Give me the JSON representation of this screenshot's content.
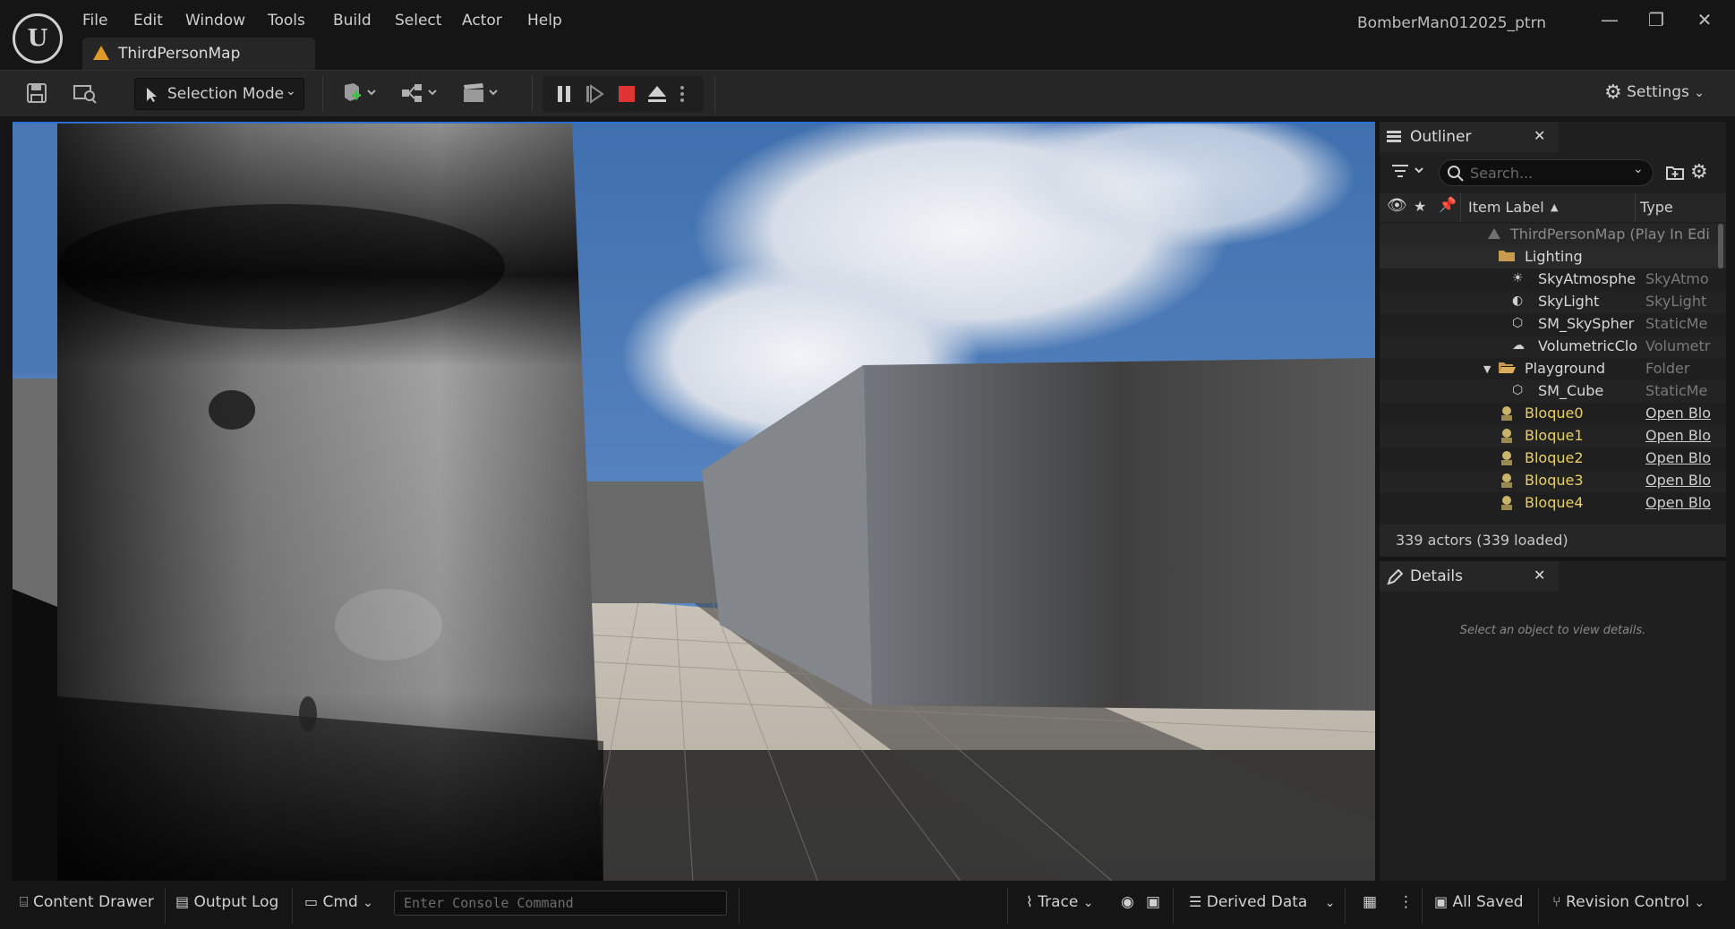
{
  "window": {
    "project_name": "BomberMan012025_ptrn",
    "minimize_glyph": "—",
    "restore_glyph": "❐",
    "close_glyph": "✕"
  },
  "menu": [
    "File",
    "Edit",
    "Window",
    "Tools",
    "Build",
    "Select",
    "Actor",
    "Help"
  ],
  "tab": {
    "label": "ThirdPersonMap"
  },
  "toolbar": {
    "selection_mode": "Selection Mode",
    "settings": "Settings",
    "icons": [
      "save-icon",
      "browse-icon",
      "add-actor-icon",
      "blueprint-icon",
      "cinematics-icon",
      "pause-icon",
      "step-icon",
      "stop-icon",
      "eject-icon",
      "more-icon",
      "gear-icon"
    ]
  },
  "outliner": {
    "title": "Outliner",
    "search_placeholder": "Search...",
    "col_label": "Item Label",
    "col_type": "Type",
    "rows": [
      {
        "label": "ThirdPersonMap (Play In Edi",
        "type": "",
        "icon": "map-icon"
      },
      {
        "label": "Lighting",
        "type": "",
        "icon": "folder-icon"
      },
      {
        "label": "SkyAtmosphe",
        "type": "SkyAtmo",
        "icon": "sky-atmosphere-icon"
      },
      {
        "label": "SkyLight",
        "type": "SkyLight",
        "icon": "skylight-icon"
      },
      {
        "label": "SM_SkySpher",
        "type": "StaticMe",
        "icon": "static-mesh-icon"
      },
      {
        "label": "VolumetricClo",
        "type": "Volumetr",
        "icon": "volumetric-cloud-icon"
      },
      {
        "label": "Playground",
        "type": "Folder",
        "icon": "folder-open-icon"
      },
      {
        "label": "SM_Cube",
        "type": "StaticMe",
        "icon": "static-mesh-icon"
      },
      {
        "label": "Bloque0",
        "type": "Open Blo",
        "icon": "blueprint-actor-icon"
      },
      {
        "label": "Bloque1",
        "type": "Open Blo",
        "icon": "blueprint-actor-icon"
      },
      {
        "label": "Bloque2",
        "type": "Open Blo",
        "icon": "blueprint-actor-icon"
      },
      {
        "label": "Bloque3",
        "type": "Open Blo",
        "icon": "blueprint-actor-icon"
      },
      {
        "label": "Bloque4",
        "type": "Open Blo",
        "icon": "blueprint-actor-icon"
      }
    ],
    "footer": "339 actors (339 loaded)"
  },
  "details": {
    "title": "Details",
    "empty_message": "Select an object to view details."
  },
  "statusbar": {
    "content_drawer": "Content Drawer",
    "output_log": "Output Log",
    "cmd": "Cmd",
    "console_placeholder": "Enter Console Command",
    "trace": "Trace",
    "derived_data": "Derived Data",
    "all_saved": "All Saved",
    "revision_control": "Revision Control"
  },
  "colors": {
    "accent": "#2a6fd6",
    "blueprint_label": "#e6cf6a",
    "map_icon": "#e09a2a"
  }
}
